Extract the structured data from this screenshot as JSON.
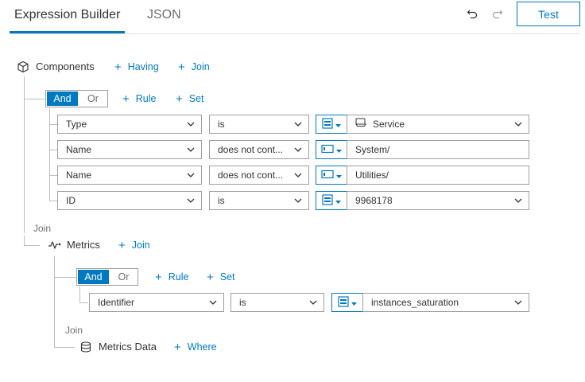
{
  "header": {
    "tabs": [
      {
        "label": "Expression Builder",
        "active": true
      },
      {
        "label": "JSON",
        "active": false
      }
    ],
    "undo_icon": "undo-icon",
    "redo_icon": "redo-icon",
    "test_label": "Test"
  },
  "colors": {
    "accent": "#0079c1",
    "text": "#323232",
    "muted": "#6e6e6e",
    "border": "#9e9e9e",
    "line": "#bdbdbd"
  },
  "root": {
    "label": "Components",
    "icon": "cube-icon",
    "having_label": "Having",
    "join_label": "Join",
    "group": {
      "and_label": "And",
      "or_label": "Or",
      "selected": "And",
      "rule_label": "Rule",
      "set_label": "Set",
      "rules": [
        {
          "field": "Type",
          "operator": "is",
          "value_type": "list",
          "value": "Service",
          "value_icon": "service-icon"
        },
        {
          "field": "Name",
          "operator": "does not cont...",
          "value_type": "text",
          "value": "System/"
        },
        {
          "field": "Name",
          "operator": "does not cont...",
          "value_type": "text",
          "value": "Utilities/"
        },
        {
          "field": "ID",
          "operator": "is",
          "value_type": "list",
          "value": "9968178"
        }
      ]
    }
  },
  "join1": {
    "caption": "Join",
    "label": "Metrics",
    "icon": "metrics-icon",
    "join_label": "Join",
    "group": {
      "and_label": "And",
      "or_label": "Or",
      "selected": "And",
      "rule_label": "Rule",
      "set_label": "Set",
      "rules": [
        {
          "field": "Identifier",
          "operator": "is",
          "value_type": "list",
          "value": "instances_saturation"
        }
      ]
    }
  },
  "join2": {
    "caption": "Join",
    "label": "Metrics Data",
    "icon": "database-icon",
    "where_label": "Where"
  }
}
